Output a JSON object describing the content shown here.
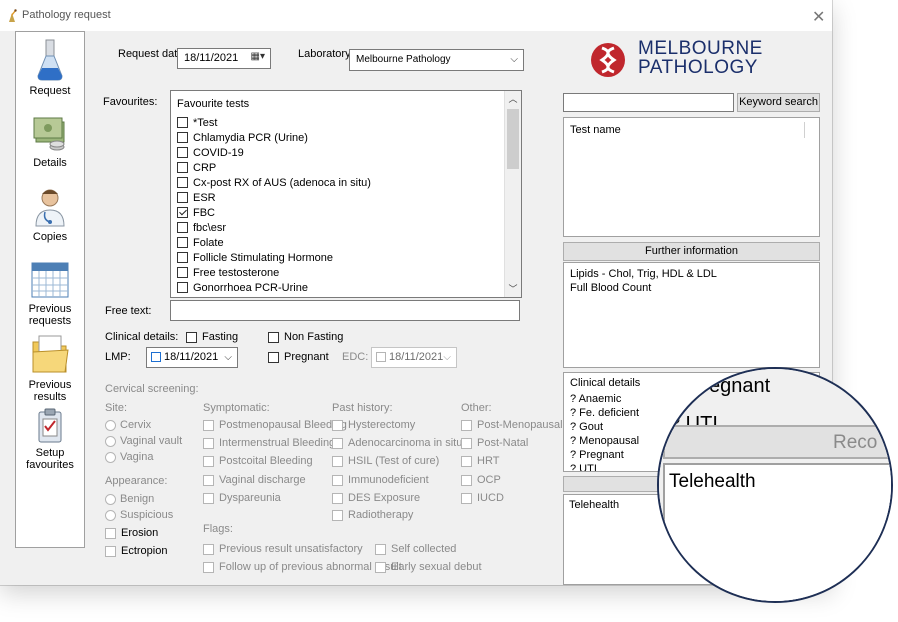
{
  "window": {
    "title": "Pathology request",
    "close_glyph": "✕"
  },
  "sidebar": {
    "items": [
      {
        "label": "Request",
        "icon": "flask-icon"
      },
      {
        "label": "Details",
        "icon": "money-icon"
      },
      {
        "label": "Copies",
        "icon": "doctor-icon"
      },
      {
        "label": "Previous requests",
        "icon": "calendar-icon"
      },
      {
        "label": "Previous results",
        "icon": "folder-icon"
      },
      {
        "label": "Setup favourites",
        "icon": "clipboard-icon"
      }
    ]
  },
  "header": {
    "request_date_label": "Request date:",
    "request_date_value": "18/11/2021",
    "laboratory_label": "Laboratory:",
    "laboratory_value": "Melbourne Pathology"
  },
  "logo": {
    "line1": "MELBOURNE",
    "line2": "PATHOLOGY",
    "color": "#1b2f6b",
    "accent": "#c0272d"
  },
  "favourites": {
    "label": "Favourites:",
    "heading": "Favourite tests",
    "items": [
      {
        "name": "*Test",
        "checked": false
      },
      {
        "name": "Chlamydia PCR  (Urine)",
        "checked": false
      },
      {
        "name": "COVID-19",
        "checked": false
      },
      {
        "name": "CRP",
        "checked": false
      },
      {
        "name": "Cx-post RX of AUS (adenoca in situ)",
        "checked": false
      },
      {
        "name": "ESR",
        "checked": false
      },
      {
        "name": "FBC",
        "checked": true
      },
      {
        "name": "fbc\\esr",
        "checked": false
      },
      {
        "name": "Folate",
        "checked": false
      },
      {
        "name": "Follicle Stimulating Hormone",
        "checked": false
      },
      {
        "name": "Free testosterone",
        "checked": false
      },
      {
        "name": "Gonorrhoea PCR-Urine",
        "checked": false
      }
    ]
  },
  "free_text": {
    "label": "Free text:",
    "value": ""
  },
  "clinical": {
    "label": "Clinical details:",
    "fasting": "Fasting",
    "non_fasting": "Non Fasting",
    "lmp_label": "LMP:",
    "lmp_value": "18/11/2021",
    "pregnant": "Pregnant",
    "edc_label": "EDC:",
    "edc_value": "18/11/2021"
  },
  "cervical": {
    "title": "Cervical screening:",
    "site_label": "Site:",
    "sites": [
      "Cervix",
      "Vaginal vault",
      "Vagina"
    ],
    "appearance_label": "Appearance:",
    "appearances": [
      "Benign",
      "Suspicious"
    ],
    "erosion": "Erosion",
    "ectropion": "Ectropion",
    "symptomatic_label": "Symptomatic:",
    "symptomatic": [
      "Postmenopausal Bleeding",
      "Intermenstrual Bleeding",
      "Postcoital Bleeding",
      "Vaginal discharge",
      "Dyspareunia"
    ],
    "past_history_label": "Past history:",
    "past_history": [
      "Hysterectomy",
      "Adenocarcinoma in situ",
      "HSIL (Test of cure)",
      "Immunodeficient",
      "DES Exposure",
      "Radiotherapy"
    ],
    "other_label": "Other:",
    "other": [
      "Post-Menopausal",
      "Post-Natal",
      "HRT",
      "OCP",
      "IUCD"
    ],
    "flags_label": "Flags:",
    "flags": [
      "Previous result unsatisfactory",
      "Self collected",
      "Follow up of previous abnormal result",
      "Early sexual debut"
    ]
  },
  "right_panel": {
    "search_value": "",
    "keyword_search_button": "Keyword search",
    "test_name_header": "Test name",
    "further_info_button": "Further information",
    "further_info_lines": [
      "Lipids - Chol, Trig, HDL & LDL",
      "Full Blood Count"
    ],
    "clinical_details_header": "Clinical details",
    "clinical_details_items": [
      "? Anaemic",
      "? Fe. deficient",
      "? Gout",
      "? Menopausal",
      "? Pregnant",
      "? UTI"
    ],
    "recommend_button": "Reco",
    "telehealth": "Telehealth"
  },
  "magnifier": {
    "line_pregnant": "Pregnant",
    "line_uti": "? UTI",
    "button_text": "Reco",
    "telehealth": "Telehealth"
  }
}
